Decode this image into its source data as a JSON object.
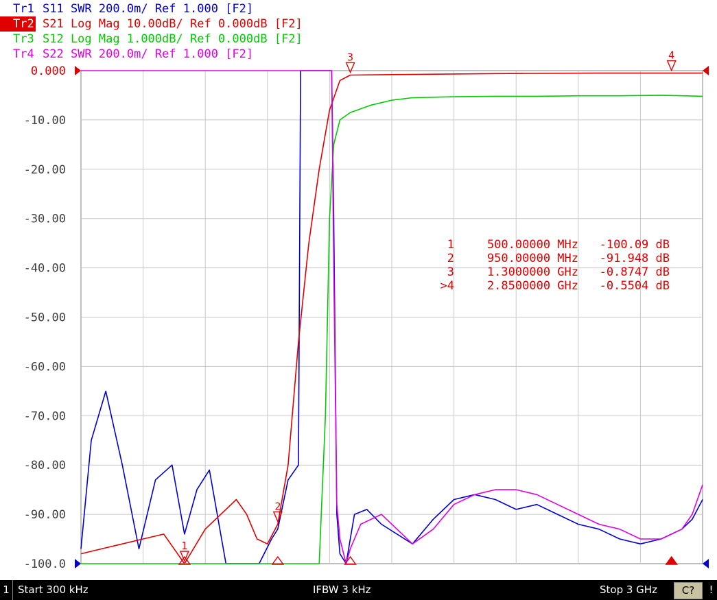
{
  "traces": [
    {
      "name": "Tr1",
      "param": "S11",
      "format": "SWR",
      "scale": "200.0m/",
      "ref": "Ref 1.000",
      "window": "[F2]",
      "color": "#0000d0",
      "active": false
    },
    {
      "name": "Tr2",
      "param": "S21",
      "format": "Log Mag",
      "scale": "10.00dB/",
      "ref": "Ref 0.000dB",
      "window": "[F2]",
      "color": "#e00000",
      "active": true
    },
    {
      "name": "Tr3",
      "param": "S12",
      "format": "Log Mag",
      "scale": "1.000dB/",
      "ref": "Ref 0.000dB",
      "window": "[F2]",
      "color": "#00cc00",
      "active": false
    },
    {
      "name": "Tr4",
      "param": "S22",
      "format": "SWR",
      "scale": "200.0m/",
      "ref": "Ref 1.000",
      "window": "[F2]",
      "color": "#e000e0",
      "active": false
    }
  ],
  "markers_table": [
    {
      "id": "1",
      "freq": "500.00000 MHz",
      "value": "-100.09 dB"
    },
    {
      "id": "2",
      "freq": "950.00000 MHz",
      "value": "-91.948 dB"
    },
    {
      "id": "3",
      "freq": "1.3000000 GHz",
      "value": "-0.8747 dB"
    },
    {
      "id": ">4",
      "freq": "2.8500000 GHz",
      "value": "-0.5504 dB"
    }
  ],
  "status": {
    "channel": "1",
    "start": "Start 300 kHz",
    "ifbw": "IFBW 3 kHz",
    "stop": "Stop 3 GHz",
    "cal": "C?",
    "excl": "!"
  },
  "chart_data": {
    "type": "line",
    "title": "",
    "xlabel": "",
    "ylabel": "",
    "xlim": [
      0.0003,
      3.0
    ],
    "x_unit": "GHz",
    "ylim": [
      -100,
      0
    ],
    "grid": true,
    "y_ticks": [
      "0.000",
      "-10.00",
      "-20.00",
      "-30.00",
      "-40.00",
      "-50.00",
      "-60.00",
      "-70.00",
      "-80.00",
      "-90.00",
      "-100.0"
    ],
    "y_tick_values": [
      0,
      -10,
      -20,
      -30,
      -40,
      -50,
      -60,
      -70,
      -80,
      -90,
      -100
    ],
    "series": [
      {
        "name": "Tr1 S11 SWR",
        "color": "#0000d0",
        "x": [
          0.0003,
          0.05,
          0.12,
          0.2,
          0.28,
          0.36,
          0.44,
          0.5,
          0.56,
          0.62,
          0.7,
          0.78,
          0.86,
          0.92,
          0.95,
          1.0,
          1.05,
          1.06,
          1.07,
          1.15,
          1.2,
          1.21,
          1.22,
          1.235,
          1.25,
          1.28,
          1.3,
          1.32,
          1.38,
          1.45,
          1.6,
          1.7,
          1.8,
          1.9,
          2.0,
          2.1,
          2.2,
          2.3,
          2.4,
          2.5,
          2.6,
          2.7,
          2.8,
          2.85,
          2.9,
          2.95,
          3.0
        ],
        "y": [
          -97,
          -75,
          -65,
          -80,
          -97,
          -83,
          -80,
          -94,
          -85,
          -81,
          -100,
          -100,
          -100,
          -95,
          -93,
          -83,
          -80,
          0,
          0,
          0,
          0,
          0,
          -30,
          -90,
          -98,
          -100,
          -95,
          -90,
          -89,
          -92,
          -96,
          -91,
          -87,
          -86,
          -87,
          -89,
          -88,
          -90,
          -92,
          -93,
          -95,
          -96,
          -95,
          -94,
          -93,
          -91,
          -87
        ]
      },
      {
        "name": "Tr2 S21 Log Mag",
        "color": "#e00000",
        "x": [
          0.0003,
          0.1,
          0.2,
          0.3,
          0.4,
          0.5,
          0.6,
          0.7,
          0.75,
          0.8,
          0.85,
          0.9,
          0.95,
          1.0,
          1.05,
          1.1,
          1.15,
          1.2,
          1.25,
          1.3,
          1.5,
          2.0,
          2.5,
          3.0
        ],
        "y": [
          -98,
          -97,
          -96,
          -95,
          -94,
          -100,
          -93,
          -89,
          -87,
          -90,
          -95,
          -96,
          -92,
          -80,
          -55,
          -35,
          -20,
          -8,
          -2,
          -0.9,
          -0.8,
          -0.6,
          -0.5,
          -0.5
        ]
      },
      {
        "name": "Tr3 S12 Log Mag",
        "color": "#00cc00",
        "x": [
          0.0003,
          0.8,
          1.1,
          1.15,
          1.18,
          1.2,
          1.22,
          1.25,
          1.3,
          1.4,
          1.5,
          1.6,
          1.8,
          2.0,
          2.2,
          2.4,
          2.6,
          2.8,
          3.0
        ],
        "y": [
          -100,
          -100,
          -100,
          -100,
          -70,
          -30,
          -15,
          -10,
          -8.5,
          -7,
          -6,
          -5.5,
          -5.3,
          -5.2,
          -5.2,
          -5.1,
          -5.1,
          -5.0,
          -5.2
        ]
      },
      {
        "name": "Tr4 S22 SWR",
        "color": "#e000e0",
        "x": [
          0.0003,
          1.1,
          1.2,
          1.21,
          1.22,
          1.235,
          1.25,
          1.28,
          1.3,
          1.35,
          1.45,
          1.6,
          1.7,
          1.8,
          1.9,
          2.0,
          2.1,
          2.2,
          2.3,
          2.4,
          2.5,
          2.6,
          2.7,
          2.8,
          2.85,
          2.9,
          2.95,
          3.0
        ],
        "y": [
          0,
          0,
          0,
          0,
          -40,
          -88,
          -95,
          -100,
          -97,
          -92,
          -90,
          -96,
          -93,
          -88,
          -86,
          -85,
          -85,
          -86,
          -88,
          -90,
          -92,
          -93,
          -95,
          -95,
          -94,
          -93,
          -90,
          -84
        ]
      }
    ],
    "markers": [
      {
        "id": "1",
        "x": 0.5
      },
      {
        "id": "2",
        "x": 0.95
      },
      {
        "id": "3",
        "x": 1.3
      },
      {
        "id": "4",
        "x": 2.85
      }
    ]
  }
}
